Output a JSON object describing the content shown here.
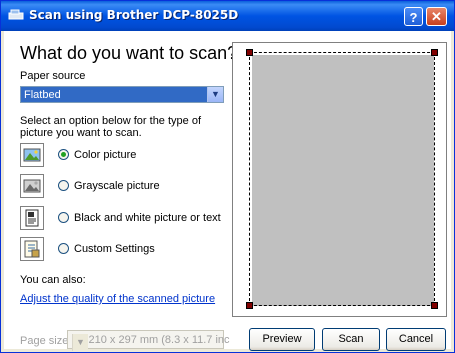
{
  "window": {
    "title": "Scan using Brother DCP-8025D",
    "help_label": "?",
    "close_label": "✕"
  },
  "main": {
    "heading": "What do you want to scan?",
    "paper_source_label": "Paper source",
    "paper_source_value": "Flatbed",
    "instructions": "Select an option below for the type of picture you want to scan.",
    "options": [
      {
        "label": "Color picture",
        "selected": true
      },
      {
        "label": "Grayscale picture",
        "selected": false
      },
      {
        "label": "Black and white picture or text",
        "selected": false
      },
      {
        "label": "Custom Settings",
        "selected": false
      }
    ],
    "also_label": "You can also:",
    "adjust_link": "Adjust the quality of the scanned picture",
    "page_size_label": "Page size:",
    "page_size_value": "A4 210 x 297 mm (8.3 x 11.7 inc"
  },
  "buttons": {
    "preview": "Preview",
    "scan": "Scan",
    "cancel": "Cancel"
  },
  "colors": {
    "title_bar": "#0054e3",
    "selection": "#316ac5",
    "link": "#0033cc",
    "radio_dot": "#21a121",
    "handle": "#800000",
    "scan_area": "#c0c0c0"
  }
}
